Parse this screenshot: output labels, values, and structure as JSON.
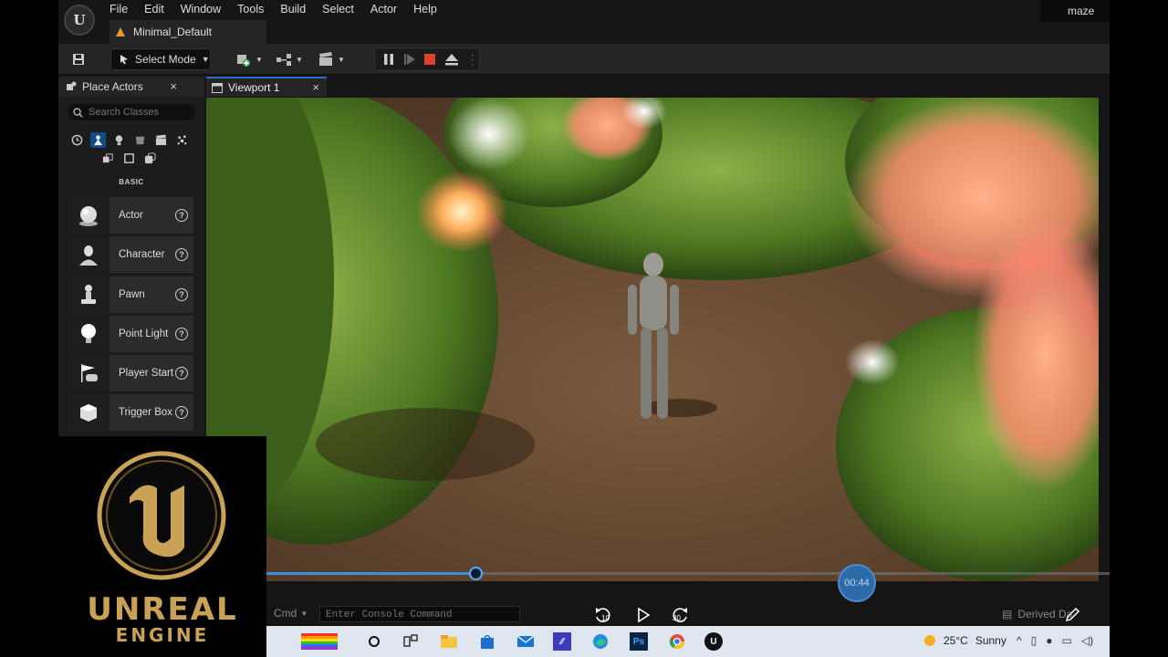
{
  "menu": {
    "items": [
      "File",
      "Edit",
      "Window",
      "Tools",
      "Build",
      "Select",
      "Actor",
      "Help"
    ],
    "project": "maze",
    "level_tab": "Minimal_Default"
  },
  "toolbar": {
    "select_mode": "Select Mode"
  },
  "place_actors": {
    "tab_label": "Place Actors",
    "search_placeholder": "Search Classes",
    "section_label": "BASIC",
    "items": [
      {
        "label": "Actor",
        "icon": "sphere-icon"
      },
      {
        "label": "Character",
        "icon": "character-icon"
      },
      {
        "label": "Pawn",
        "icon": "pawn-icon"
      },
      {
        "label": "Point Light",
        "icon": "lightbulb-icon"
      },
      {
        "label": "Player Start",
        "icon": "player-start-icon"
      },
      {
        "label": "Trigger Box",
        "icon": "trigger-box-icon"
      }
    ]
  },
  "viewport": {
    "tab_label": "Viewport 1"
  },
  "overlay_logo": {
    "word1": "UNREAL",
    "word2": "ENGINE"
  },
  "video": {
    "progress_fraction": 0.248,
    "time": "00:44",
    "rewind_label": "10",
    "forward_label": "30"
  },
  "bottombar": {
    "cmd": "Cmd",
    "console_placeholder": "Enter Console Command",
    "derived": "Derived Da"
  },
  "taskbar": {
    "temperature": "25°C",
    "condition": "Sunny"
  },
  "colors": {
    "accent": "#2a6cc7",
    "stop": "#e0402f",
    "progress": "#3f8ddb",
    "logo_gold": "#c9a255"
  }
}
